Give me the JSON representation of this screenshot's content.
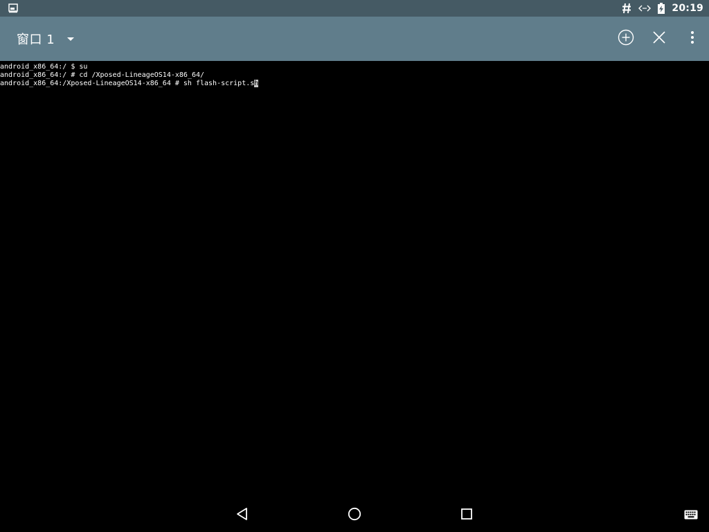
{
  "status_bar": {
    "time": "20:19",
    "icons": [
      "screenshot-icon",
      "hash-icon",
      "code-arrows-icon",
      "battery-charging-icon"
    ]
  },
  "app_bar": {
    "window_title": "窗口 1",
    "actions": [
      "add-window-icon",
      "close-window-icon",
      "overflow-menu-icon"
    ]
  },
  "terminal": {
    "lines": [
      "android_x86_64:/ $ su",
      "android_x86_64:/ # cd /Xposed-LineageOS14-x86_64/",
      "android_x86_64:/Xposed-LineageOS14-x86_64 # sh flash-script.s"
    ],
    "cursor_char": "h"
  },
  "nav_bar": {
    "buttons": [
      "back-icon",
      "home-icon",
      "recents-icon",
      "keyboard-icon"
    ]
  }
}
